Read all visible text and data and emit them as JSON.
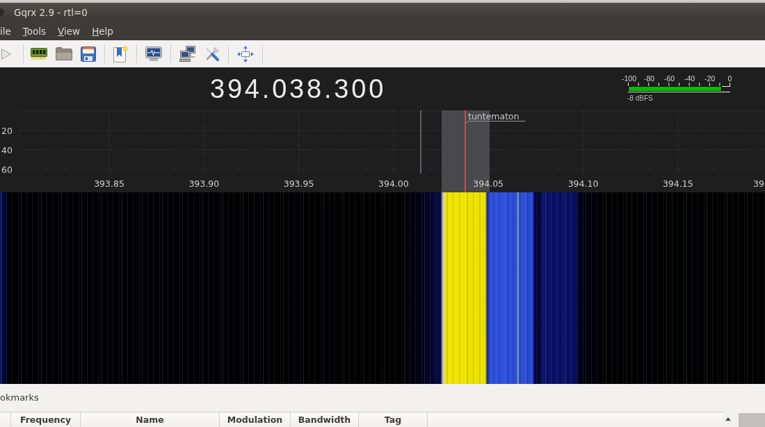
{
  "window": {
    "title": "Gqrx 2.9 - rtl=0"
  },
  "menu": [
    {
      "label": "ile",
      "mnemonic_shown": false
    },
    {
      "label": "Tools",
      "mnemonic_shown": true
    },
    {
      "label": "View",
      "mnemonic_shown": true
    },
    {
      "label": "Help",
      "mnemonic_shown": true
    }
  ],
  "frequency_display": "394.038.300",
  "meter": {
    "scale": [
      "-100",
      "-80",
      "-60",
      "-40",
      "-20",
      "0"
    ],
    "level": 0.92,
    "reading": "-8 dBFS"
  },
  "plotter": {
    "y_labels": [
      "20",
      "40",
      "60"
    ],
    "x_labels": [
      "393.85",
      "393.90",
      "393.95",
      "394.00",
      "394.05",
      "394.10",
      "394.15",
      "39"
    ],
    "bookmark": "tuntematon"
  },
  "bookmarks_panel": {
    "title": "okmarks",
    "columns": [
      "Frequency",
      "Name",
      "Modulation",
      "Bandwidth",
      "Tag"
    ]
  }
}
